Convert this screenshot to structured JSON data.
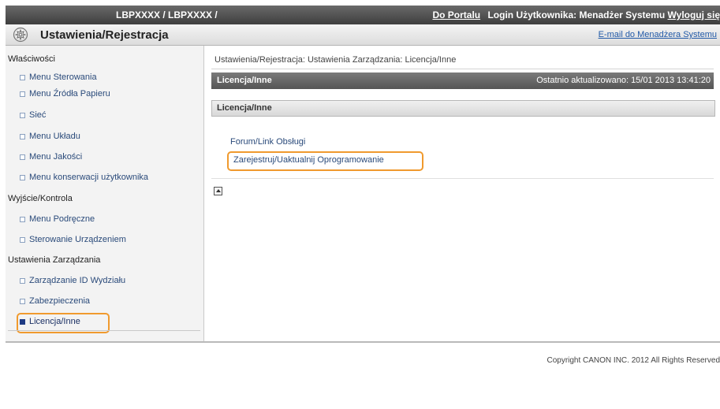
{
  "topbar": {
    "product": "LBPXXXX / LBPXXXX /",
    "portal_link": "Do Portalu",
    "login_info": "Login Użytkownika: Menadżer Systemu",
    "logout_link": "Wyloguj się"
  },
  "titlebar": {
    "title": "Ustawienia/Rejestracja",
    "email_link": "E-mail do Menadżera Systemu",
    "icon": "gear-icon"
  },
  "sidebar": {
    "section1": "Właściwości",
    "section1_items": [
      "Menu Sterowania",
      "Menu Źródła Papieru",
      "Sieć",
      "Menu Układu",
      "Menu Jakości",
      "Menu konserwacji użytkownika"
    ],
    "section2": "Wyjście/Kontrola",
    "section2_items": [
      "Menu Podręczne",
      "Sterowanie Urządzeniem"
    ],
    "section3": "Ustawienia Zarządzania",
    "section3_items": [
      "Zarządzanie ID Wydziału",
      "Zabezpieczenia",
      "Licencja/Inne"
    ],
    "active_item": "Licencja/Inne"
  },
  "main": {
    "breadcrumb": "Ustawienia/Rejestracja: Ustawienia Zarządzania: Licencja/Inne",
    "header_title": "Licencja/Inne",
    "last_updated": "Ostatnio aktualizowano: 15/01 2013 13:41:20",
    "subheader": "Licencja/Inne",
    "links": [
      "Forum/Link Obsługi",
      "Zarejestruj/Uaktualnij Oprogramowanie"
    ]
  },
  "footer": {
    "copyright": "Copyright CANON INC. 2012 All Rights Reserved"
  },
  "colors": {
    "highlight": "#f09a2e",
    "link": "#2a4a7a",
    "header_dark": "#555555"
  }
}
